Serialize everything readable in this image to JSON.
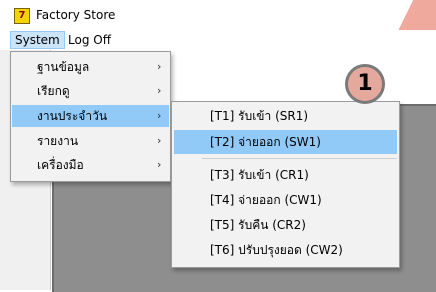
{
  "window": {
    "title": "Factory Store",
    "app_icon": "factory-store-icon"
  },
  "menubar": {
    "items": [
      {
        "label": "System",
        "active": true
      },
      {
        "label": "Log Off",
        "active": false
      }
    ]
  },
  "system_menu": {
    "items": [
      {
        "label": "ฐานข้อมูล",
        "has_submenu": true,
        "active": false
      },
      {
        "label": "เรียกดู",
        "has_submenu": true,
        "active": false
      },
      {
        "label": "งานประจำวัน",
        "has_submenu": true,
        "active": true
      },
      {
        "label": "รายงาน",
        "has_submenu": true,
        "active": false
      },
      {
        "label": "เครื่องมือ",
        "has_submenu": true,
        "active": false
      }
    ],
    "arrow": "›"
  },
  "daily_submenu": {
    "items": [
      {
        "label": "[T1] รับเข้า (SR1)",
        "active": false
      },
      {
        "label": "[T2] จ่ายออก (SW1)",
        "active": true
      },
      {
        "label": "[T3] รับเข้า (CR1)",
        "active": false
      },
      {
        "label": "[T4] จ่ายออก (CW1)",
        "active": false
      },
      {
        "label": "[T5] รับคืน (CR2)",
        "active": false
      },
      {
        "label": "[T6] ปรับปรุงยอด (CW2)",
        "active": false
      }
    ]
  },
  "annotation": {
    "step_number": "1"
  },
  "colors": {
    "menu_highlight": "#91c9f7",
    "menubar_active": "#cce4f7",
    "annotation_fill": "#e4a89d",
    "panel_gray": "#8e8e8e"
  }
}
